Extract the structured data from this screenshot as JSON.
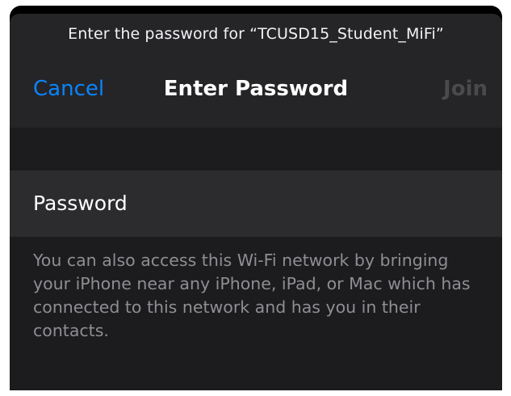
{
  "prompt": "Enter the password for “TCUSD15_Student_MiFi”",
  "nav": {
    "cancel_label": "Cancel",
    "title": "Enter Password",
    "join_label": "Join"
  },
  "password_field": {
    "label": "Password",
    "value": ""
  },
  "footnote": "You can also access this Wi-Fi network by bringing your iPhone near any iPhone, iPad, or Mac which has connected to this network and has you in their contacts.",
  "colors": {
    "accent": "#0a84ff",
    "disabled": "#4a4a4d",
    "background": "#1c1c1e",
    "cell": "#2c2c2e"
  }
}
